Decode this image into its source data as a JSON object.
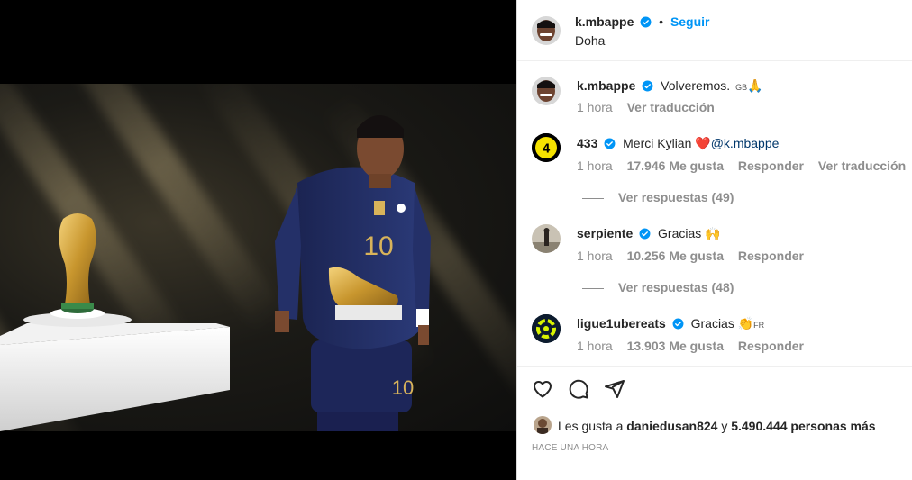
{
  "header": {
    "username": "k.mbappe",
    "follow_label": "Seguir",
    "location": "Doha"
  },
  "caption": {
    "username": "k.mbappe",
    "text": "Volveremos.",
    "flag_text": "GB",
    "emoji": "🙏",
    "time": "1 hora",
    "translate_label": "Ver traducción"
  },
  "comments": [
    {
      "username": "433",
      "text": "Merci Kylian",
      "emoji": "❤️",
      "mention": "@k.mbappe",
      "time": "1 hora",
      "likes": "17.946 Me gusta",
      "reply_label": "Responder",
      "translate_label": "Ver traducción",
      "replies_label": "Ver respuestas (49)"
    },
    {
      "username": "serpiente",
      "text": "Gracias",
      "emoji": "🙌",
      "time": "1 hora",
      "likes": "10.256 Me gusta",
      "reply_label": "Responder",
      "replies_label": "Ver respuestas (48)"
    },
    {
      "username": "ligue1ubereats",
      "text": "Gracias",
      "emoji": "👏",
      "flag_text": "FR",
      "time": "1 hora",
      "likes": "13.903 Me gusta",
      "reply_label": "Responder"
    }
  ],
  "likes_summary": {
    "prefix": "Les gusta a",
    "user": "daniedusan824",
    "connector": "y",
    "others": "5.490.444 personas más"
  },
  "timestamp": "HACE UNA HORA",
  "icons": {
    "like": "heart-icon",
    "comment": "comment-icon",
    "share": "share-icon",
    "verified": "verified-badge-icon"
  },
  "colors": {
    "accent": "#0095f6",
    "heart": "#ed4956",
    "muted": "#8e8e8e"
  }
}
